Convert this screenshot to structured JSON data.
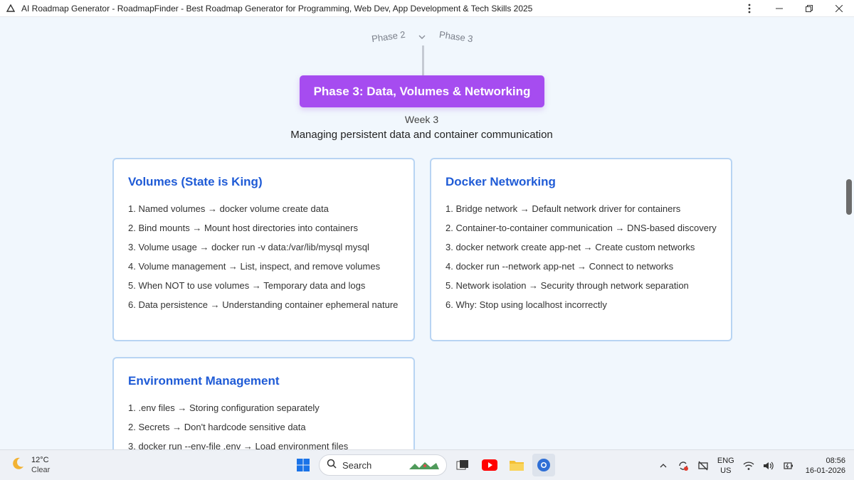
{
  "window": {
    "title": "AI Roadmap Generator - RoadmapFinder - Best Roadmap Generator for Programming, Web Dev, App Development & Tech Skills 2025"
  },
  "nav": {
    "phase_prev": "Phase 2",
    "phase_next": "Phase 3"
  },
  "phase": {
    "title": "Phase 3: Data, Volumes & Networking",
    "week": "Week 3",
    "subtitle": "Managing persistent data and container communication"
  },
  "cards": [
    {
      "title": "Volumes (State is King)",
      "items": [
        "1. Named volumes → docker volume create data",
        "2. Bind mounts → Mount host directories into containers",
        "3. Volume usage → docker run -v data:/var/lib/mysql mysql",
        "4. Volume management → List, inspect, and remove volumes",
        "5. When NOT to use volumes → Temporary data and logs",
        "6. Data persistence → Understanding container ephemeral nature"
      ]
    },
    {
      "title": "Docker Networking",
      "items": [
        "1. Bridge network → Default network driver for containers",
        "2. Container-to-container communication → DNS-based discovery",
        "3. docker network create app-net → Create custom networks",
        "4. docker run --network app-net → Connect to networks",
        "5. Network isolation → Security through network separation",
        "6. Why: Stop using localhost incorrectly"
      ]
    },
    {
      "title": "Environment Management",
      "items": [
        "1. .env files → Storing configuration separately",
        "2. Secrets → Don't hardcode sensitive data",
        "3. docker run --env-file .env → Load environment files"
      ]
    }
  ],
  "taskbar": {
    "weather_temp": "12°C",
    "weather_desc": "Clear",
    "search_label": "Search",
    "lang_top": "ENG",
    "lang_bottom": "US",
    "time": "08:56",
    "date": "16-01-2026",
    "accent": "#a64cf0"
  }
}
